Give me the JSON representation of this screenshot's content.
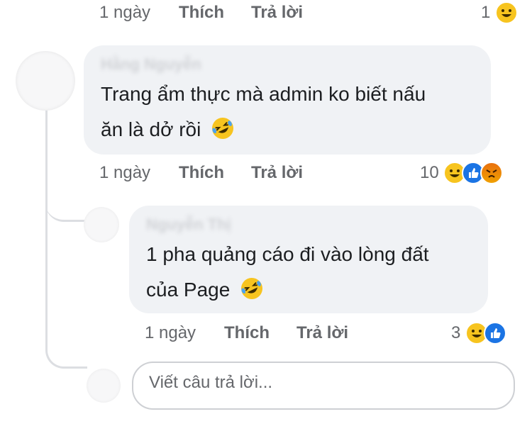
{
  "top_meta": {
    "time": "1 ngày",
    "like": "Thích",
    "reply": "Trả lời",
    "reaction_count": "1",
    "reaction_icons": [
      "haha"
    ]
  },
  "comment1": {
    "author_blurred": "Hằng Nguyễn",
    "text_line1": "Trang ẩm thực mà admin ko biết nấu",
    "text_line2": "ăn là dở rồi",
    "emoji": "rolling-on-floor-laughing",
    "meta": {
      "time": "1 ngày",
      "like": "Thích",
      "reply": "Trả lời",
      "reaction_count": "10",
      "reaction_icons": [
        "haha",
        "like",
        "angry"
      ]
    }
  },
  "reply1": {
    "author_blurred": "Nguyễn Thị",
    "text_line1": "1 pha quảng cáo đi vào lòng đất",
    "text_line2": "của Page",
    "emoji": "rolling-on-floor-laughing",
    "meta": {
      "time": "1 ngày",
      "like": "Thích",
      "reply": "Trả lời",
      "reaction_count": "3",
      "reaction_icons": [
        "haha",
        "like"
      ]
    }
  },
  "reply_box": {
    "placeholder": "Viết câu trả lời..."
  },
  "colors": {
    "bubble": "#f0f2f5",
    "meta_text": "#65676b",
    "comment_text": "#1c1e21",
    "like_blue": "#1b74e4",
    "haha_yellow": "#f7c41f"
  }
}
